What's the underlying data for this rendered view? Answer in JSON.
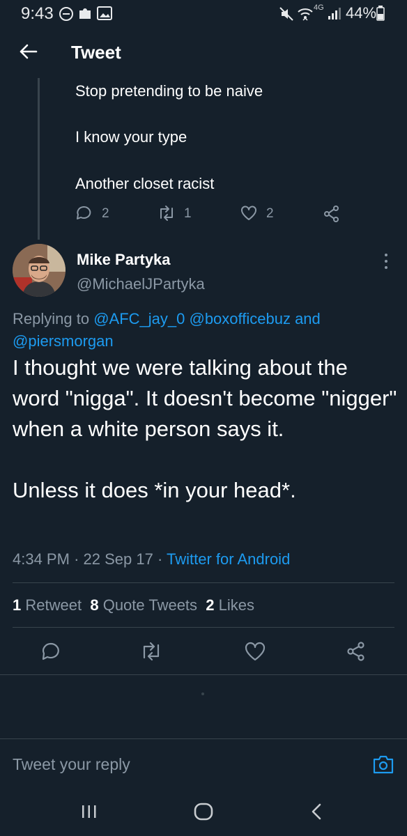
{
  "status_bar": {
    "time": "9:43",
    "battery": "44%",
    "network": "4G",
    "icons": [
      "dnd-icon",
      "puzzle-icon",
      "image-icon",
      "mute-icon",
      "wifi-icon",
      "signal-icon",
      "battery-icon"
    ]
  },
  "header": {
    "title": "Tweet"
  },
  "previous_tweet": {
    "lines": [
      "Stop pretending to be naive",
      "I know your type",
      "Another closet racist"
    ],
    "reply_count": "2",
    "retweet_count": "1",
    "like_count": "2"
  },
  "tweet": {
    "author_name": "Mike Partyka",
    "author_handle": "@MichaelJPartyka",
    "replying_prefix": "Replying to ",
    "mentions": [
      "@AFC_jay_0",
      "@boxofficebuz",
      "@piersmorgan"
    ],
    "replying_and": " and",
    "text": "I thought we were talking about the word \"nigga\". It doesn't become \"nigger\" when a white person says it.\n\nUnless it does *in your head*.",
    "time": "4:34 PM",
    "date": "22 Sep 17",
    "source": "Twitter for Android",
    "separator": "·"
  },
  "stats": {
    "retweets_count": "1",
    "retweets_label": "Retweet",
    "quotes_count": "8",
    "quotes_label": "Quote Tweets",
    "likes_count": "2",
    "likes_label": "Likes"
  },
  "reply_box": {
    "placeholder": "Tweet your reply"
  },
  "colors": {
    "background": "#15202b",
    "accent": "#1d9bf0",
    "muted": "#8b98a5",
    "divider": "#38444d"
  }
}
